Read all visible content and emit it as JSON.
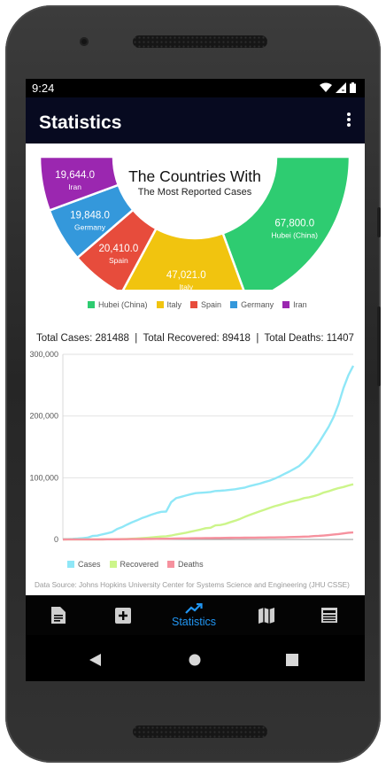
{
  "status_bar": {
    "time": "9:24"
  },
  "app_bar": {
    "title": "Statistics",
    "menu_icon": "more-vert-icon"
  },
  "pie": {
    "center_title": "The Countries With",
    "center_subtitle": "The Most Reported Cases",
    "slices": [
      {
        "label": "Hubei (China)",
        "value": 67800,
        "value_text": "67,800.0",
        "color": "#2ecc71"
      },
      {
        "label": "Italy",
        "value": 47021,
        "value_text": "47,021.0",
        "color": "#f1c40f"
      },
      {
        "label": "Spain",
        "value": 20410,
        "value_text": "20,410.0",
        "color": "#e74c3c"
      },
      {
        "label": "Germany",
        "value": 19848,
        "value_text": "19,848.0",
        "color": "#3498db"
      },
      {
        "label": "Iran",
        "value": 19644,
        "value_text": "19,644.0",
        "color": "#9b27b0"
      }
    ]
  },
  "totals": {
    "text": "Total Cases: 281488  |  Total Recovered: 89418  |  Total Deaths: 11407"
  },
  "line_legend": [
    {
      "label": "Cases",
      "color": "#8fe7f7"
    },
    {
      "label": "Recovered",
      "color": "#ccf58a"
    },
    {
      "label": "Deaths",
      "color": "#f6919e"
    }
  ],
  "source_text": "Data Source: Johns Hopkins University Center for Systems Science and Engineering (JHU CSSE)",
  "chart_data": {
    "type": "line",
    "ylim": [
      0,
      300000
    ],
    "y_ticks": [
      "0",
      "100,000",
      "200,000",
      "300,000"
    ],
    "x": [
      0,
      1,
      2,
      3,
      4,
      5,
      6,
      7,
      8,
      9,
      10,
      11,
      12,
      13,
      14,
      15,
      16,
      17,
      18,
      19,
      20,
      21,
      22,
      23,
      24,
      25,
      26,
      27,
      28,
      29,
      30,
      31,
      32,
      33,
      34,
      35,
      36,
      37,
      38,
      39,
      40,
      41,
      42,
      43,
      44,
      45,
      46,
      47,
      48,
      49,
      50,
      51,
      52,
      53,
      54,
      55,
      56,
      57,
      58,
      59
    ],
    "series": [
      {
        "name": "Cases",
        "color": "#8fe7f7",
        "values": [
          555,
          654,
          941,
          1434,
          2118,
          2927,
          5578,
          6166,
          8234,
          9927,
          12038,
          16787,
          19881,
          23892,
          27635,
          30794,
          34391,
          37120,
          40150,
          42762,
          44802,
          45221,
          60368,
          66885,
          69030,
          71224,
          73258,
          75136,
          75639,
          76197,
          76819,
          78572,
          78958,
          79561,
          80406,
          81388,
          82746,
          84112,
          86604,
          88585,
          90443,
          93016,
          95314,
          98425,
          102050,
          106099,
          109991,
          114381,
          118948,
          126214,
          134576,
          145483,
          156653,
          169593,
          182490,
          198238,
          218822,
          244933,
          265893,
          281488
        ]
      },
      {
        "name": "Recovered",
        "color": "#ccf58a",
        "values": [
          28,
          30,
          36,
          39,
          52,
          61,
          107,
          126,
          143,
          222,
          284,
          472,
          623,
          852,
          1124,
          1487,
          2011,
          2616,
          3244,
          3946,
          4683,
          5150,
          6295,
          8058,
          9395,
          10865,
          12583,
          14352,
          16121,
          18177,
          18890,
          22886,
          23394,
          25227,
          27905,
          30384,
          33277,
          36711,
          39782,
          42716,
          45602,
          48228,
          51170,
          53796,
          55865,
          58358,
          60694,
          62494,
          64404,
          67003,
          68324,
          70251,
          72624,
          76034,
          78088,
          80840,
          83207,
          84962,
          87403,
          89418
        ]
      },
      {
        "name": "Deaths",
        "color": "#f6919e",
        "values": [
          17,
          18,
          26,
          42,
          56,
          82,
          131,
          133,
          171,
          213,
          259,
          362,
          426,
          492,
          564,
          634,
          719,
          806,
          906,
          1013,
          1113,
          1118,
          1371,
          1523,
          1666,
          1770,
          1868,
          2007,
          2122,
          2247,
          2251,
          2458,
          2469,
          2629,
          2708,
          2770,
          2814,
          2872,
          2941,
          2996,
          3085,
          3160,
          3254,
          3348,
          3460,
          3558,
          3802,
          3988,
          4262,
          4615,
          4720,
          5404,
          5819,
          6440,
          7126,
          7905,
          8733,
          9867,
          10842,
          11407
        ]
      }
    ]
  }
}
